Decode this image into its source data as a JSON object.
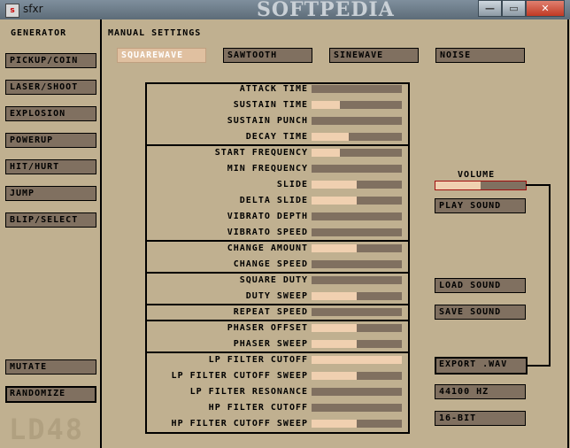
{
  "window": {
    "title": "sfxr",
    "watermark": "SOFTPEDIA",
    "min_label": "—",
    "max_label": "▭",
    "close_label": "✕"
  },
  "generator": {
    "heading": "GENERATOR",
    "buttons": [
      "PICKUP/COIN",
      "LASER/SHOOT",
      "EXPLOSION",
      "POWERUP",
      "HIT/HURT",
      "JUMP",
      "BLIP/SELECT"
    ],
    "mutate": "MUTATE",
    "randomize": "RANDOMIZE"
  },
  "manual": {
    "heading": "MANUAL SETTINGS",
    "waves": [
      "SQUAREWAVE",
      "SAWTOOTH",
      "SINEWAVE",
      "NOISE"
    ],
    "selected_wave": "SQUAREWAVE"
  },
  "params": [
    {
      "label": "ATTACK TIME",
      "value": 0.0
    },
    {
      "label": "SUSTAIN TIME",
      "value": 0.31
    },
    {
      "label": "SUSTAIN PUNCH",
      "value": 0.0
    },
    {
      "label": "DECAY TIME",
      "value": 0.41
    },
    {
      "label": "START FREQUENCY",
      "value": 0.31
    },
    {
      "label": "MIN FREQUENCY",
      "value": 0.0
    },
    {
      "label": "SLIDE",
      "value": 0.5
    },
    {
      "label": "DELTA SLIDE",
      "value": 0.5
    },
    {
      "label": "VIBRATO DEPTH",
      "value": 0.0
    },
    {
      "label": "VIBRATO SPEED",
      "value": 0.0
    },
    {
      "label": "CHANGE AMOUNT",
      "value": 0.5
    },
    {
      "label": "CHANGE SPEED",
      "value": 0.0
    },
    {
      "label": "SQUARE DUTY",
      "value": 0.0
    },
    {
      "label": "DUTY SWEEP",
      "value": 0.5
    },
    {
      "label": "REPEAT SPEED",
      "value": 0.0
    },
    {
      "label": "PHASER OFFSET",
      "value": 0.5
    },
    {
      "label": "PHASER SWEEP",
      "value": 0.5
    },
    {
      "label": "LP FILTER CUTOFF",
      "value": 1.0
    },
    {
      "label": "LP FILTER CUTOFF SWEEP",
      "value": 0.5
    },
    {
      "label": "LP FILTER RESONANCE",
      "value": 0.0
    },
    {
      "label": "HP FILTER CUTOFF",
      "value": 0.0
    },
    {
      "label": "HP FILTER CUTOFF SWEEP",
      "value": 0.5
    }
  ],
  "right": {
    "volume_label": "VOLUME",
    "volume_value": 0.5,
    "play": "PLAY SOUND",
    "load": "LOAD SOUND",
    "save": "SAVE SOUND",
    "export": "EXPORT .WAV",
    "rate": "44100 HZ",
    "bits": "16-BIT"
  },
  "logo": "LD48",
  "colors": {
    "bg": "#c0b090",
    "button": "#807060",
    "fill": "#f0d0b0",
    "selected": "#e0c0a0",
    "volume_border": "#a01010"
  }
}
